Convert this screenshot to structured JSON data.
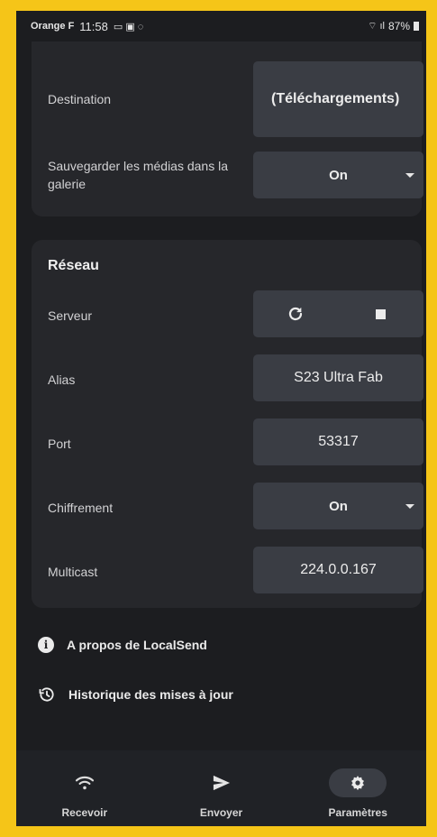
{
  "status_bar": {
    "carrier": "Orange F",
    "time": "11:58",
    "battery": "87%"
  },
  "storage": {
    "destination_label": "Destination",
    "destination_value": "(Téléchargements)",
    "gallery_label": "Sauvegarder les médias dans la galerie",
    "gallery_value": "On"
  },
  "network": {
    "title": "Réseau",
    "server_label": "Serveur",
    "alias_label": "Alias",
    "alias_value": "S23 Ultra Fab",
    "port_label": "Port",
    "port_value": "53317",
    "encryption_label": "Chiffrement",
    "encryption_value": "On",
    "multicast_label": "Multicast",
    "multicast_value": "224.0.0.167"
  },
  "links": {
    "about": "A propos de LocalSend",
    "history": "Historique des mises à jour"
  },
  "nav": {
    "receive": "Recevoir",
    "send": "Envoyer",
    "settings": "Paramètres",
    "active": "settings"
  }
}
